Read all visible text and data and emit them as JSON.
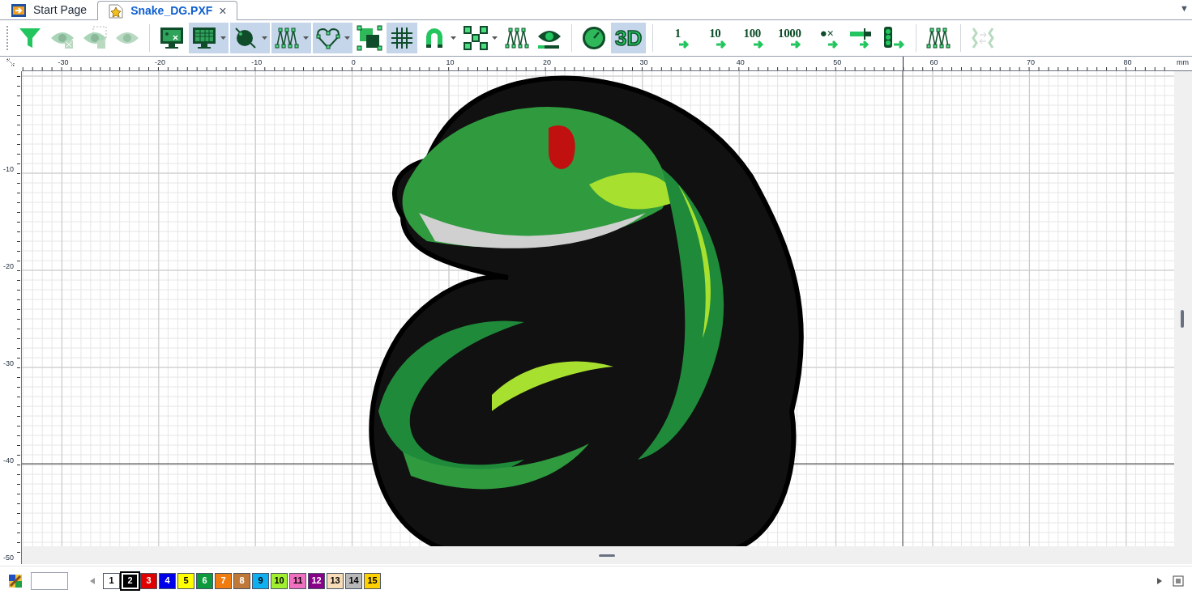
{
  "tabs": [
    {
      "label": "Start Page",
      "selected": false,
      "closable": false
    },
    {
      "label": "Snake_DG.PXF",
      "selected": true,
      "closable": true,
      "close": "×"
    }
  ],
  "tab_menu": "▼",
  "toolbar": [
    {
      "kind": "filter",
      "selected": false,
      "disabled": false,
      "dropdown": false
    },
    {
      "kind": "eye-x",
      "selected": false,
      "disabled": true,
      "dropdown": false
    },
    {
      "kind": "eye-frame",
      "selected": false,
      "disabled": true,
      "dropdown": false
    },
    {
      "kind": "eye",
      "selected": false,
      "disabled": true,
      "dropdown": false
    },
    {
      "kind": "sep"
    },
    {
      "kind": "monitor-x",
      "selected": false,
      "disabled": false,
      "dropdown": false
    },
    {
      "kind": "monitor-grid",
      "selected": true,
      "disabled": false,
      "dropdown": true
    },
    {
      "kind": "needle",
      "selected": true,
      "disabled": false,
      "dropdown": true
    },
    {
      "kind": "zigzag",
      "selected": true,
      "disabled": false,
      "dropdown": true
    },
    {
      "kind": "heart",
      "selected": true,
      "disabled": false,
      "dropdown": true
    },
    {
      "kind": "squares",
      "selected": false,
      "disabled": false,
      "dropdown": false
    },
    {
      "kind": "grid",
      "selected": true,
      "disabled": false,
      "dropdown": false
    },
    {
      "kind": "magnet",
      "selected": false,
      "disabled": false,
      "dropdown": true
    },
    {
      "kind": "nodes",
      "selected": false,
      "disabled": false,
      "dropdown": true
    },
    {
      "kind": "zigzag",
      "selected": false,
      "disabled": false,
      "dropdown": false
    },
    {
      "kind": "eye-bar",
      "selected": false,
      "disabled": false,
      "dropdown": false
    },
    {
      "kind": "sep"
    },
    {
      "kind": "gauge",
      "selected": false,
      "disabled": false,
      "dropdown": false
    },
    {
      "kind": "text",
      "label": "3D",
      "selected": true,
      "disabled": false,
      "dropdown": false
    },
    {
      "kind": "sep"
    },
    {
      "kind": "step",
      "label": "1",
      "selected": false,
      "disabled": false,
      "dropdown": false
    },
    {
      "kind": "step",
      "label": "10",
      "selected": false,
      "disabled": false,
      "dropdown": false
    },
    {
      "kind": "step",
      "label": "100",
      "selected": false,
      "disabled": false,
      "dropdown": false
    },
    {
      "kind": "step",
      "label": "1000",
      "selected": false,
      "disabled": false,
      "dropdown": false
    },
    {
      "kind": "step",
      "label": "●×",
      "selected": false,
      "disabled": false,
      "dropdown": false
    },
    {
      "kind": "step-bar",
      "selected": false,
      "disabled": false,
      "dropdown": false
    },
    {
      "kind": "step-light",
      "selected": false,
      "disabled": false,
      "dropdown": false
    },
    {
      "kind": "sep"
    },
    {
      "kind": "zigzag",
      "selected": false,
      "disabled": false,
      "dropdown": false
    },
    {
      "kind": "sep"
    },
    {
      "kind": "swap",
      "selected": false,
      "disabled": true,
      "dropdown": false
    }
  ],
  "ruler_top": {
    "labels": [
      "-30",
      "-20",
      "-10",
      "0",
      "10",
      "20",
      "30",
      "40",
      "50",
      "60",
      "70",
      "80"
    ],
    "unit": "mm"
  },
  "ruler_left": {
    "labels": [
      "-10",
      "-20",
      "-30",
      "-40",
      "-50"
    ]
  },
  "threads": [
    {
      "label": "1",
      "color": "#ffffff",
      "selected": false
    },
    {
      "label": "2",
      "color": "#000000",
      "selected": true
    },
    {
      "label": "3",
      "color": "#e00000",
      "selected": false
    },
    {
      "label": "4",
      "color": "#0000e8",
      "selected": false
    },
    {
      "label": "5",
      "color": "#ffff00",
      "selected": false
    },
    {
      "label": "6",
      "color": "#0c9a3c",
      "selected": false
    },
    {
      "label": "7",
      "color": "#f07c10",
      "selected": false
    },
    {
      "label": "8",
      "color": "#c07838",
      "selected": false
    },
    {
      "label": "9",
      "color": "#10b0f0",
      "selected": false
    },
    {
      "label": "10",
      "color": "#a0f030",
      "selected": false
    },
    {
      "label": "11",
      "color": "#f070c0",
      "selected": false
    },
    {
      "label": "12",
      "color": "#880088",
      "selected": false
    },
    {
      "label": "13",
      "color": "#f8dcb8",
      "selected": false
    },
    {
      "label": "14",
      "color": "#b8b8b8",
      "selected": false
    },
    {
      "label": "15",
      "color": "#ffd000",
      "selected": false
    }
  ]
}
